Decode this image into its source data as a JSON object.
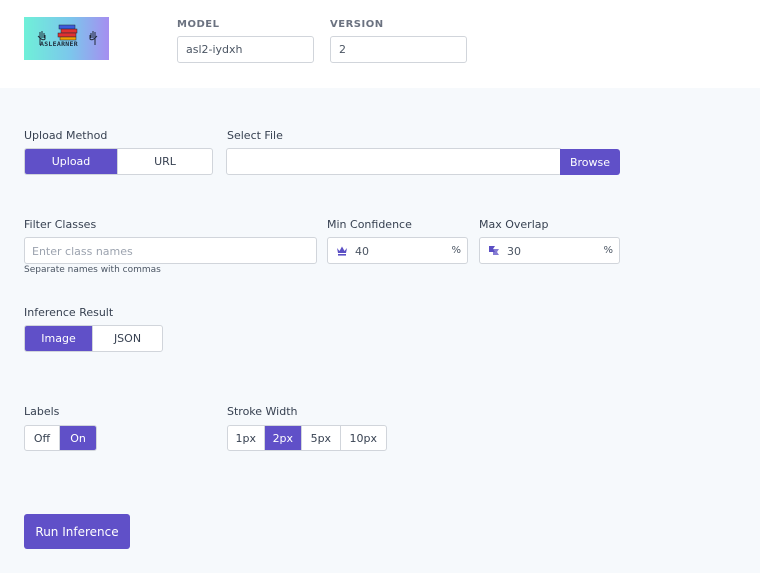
{
  "header": {
    "logo_text": "ASLEARNER",
    "model_label": "MODEL",
    "model_value": "asl2-iydxh",
    "version_label": "VERSION",
    "version_value": "2"
  },
  "upload_method": {
    "label": "Upload Method",
    "options": [
      "Upload",
      "URL"
    ],
    "selected": "Upload"
  },
  "select_file": {
    "label": "Select File",
    "value": "",
    "browse_label": "Browse"
  },
  "filter_classes": {
    "label": "Filter Classes",
    "placeholder": "Enter class names",
    "hint": "Separate names with commas"
  },
  "min_confidence": {
    "label": "Min Confidence",
    "value": "40",
    "unit": "%",
    "icon": "crown-icon"
  },
  "max_overlap": {
    "label": "Max Overlap",
    "value": "30",
    "unit": "%",
    "icon": "overlap-icon"
  },
  "inference_result": {
    "label": "Inference Result",
    "options": [
      "Image",
      "JSON"
    ],
    "selected": "Image"
  },
  "labels": {
    "label": "Labels",
    "options": [
      "Off",
      "On"
    ],
    "selected": "On"
  },
  "stroke_width": {
    "label": "Stroke Width",
    "options": [
      "1px",
      "2px",
      "5px",
      "10px"
    ],
    "selected": "2px"
  },
  "run_button": "Run Inference",
  "colors": {
    "accent": "#6050c8",
    "background": "#f6f9fc"
  }
}
